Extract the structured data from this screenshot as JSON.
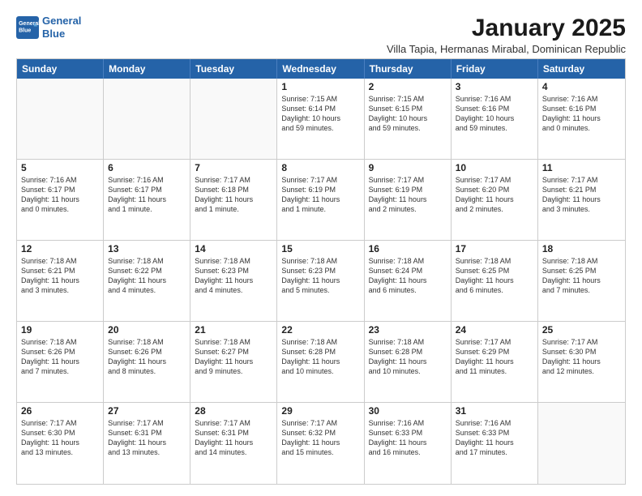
{
  "logo": {
    "line1": "General",
    "line2": "Blue"
  },
  "title": "January 2025",
  "subtitle": "Villa Tapia, Hermanas Mirabal, Dominican Republic",
  "dayHeaders": [
    "Sunday",
    "Monday",
    "Tuesday",
    "Wednesday",
    "Thursday",
    "Friday",
    "Saturday"
  ],
  "weeks": [
    [
      {
        "date": "",
        "info": ""
      },
      {
        "date": "",
        "info": ""
      },
      {
        "date": "",
        "info": ""
      },
      {
        "date": "1",
        "info": "Sunrise: 7:15 AM\nSunset: 6:14 PM\nDaylight: 10 hours\nand 59 minutes."
      },
      {
        "date": "2",
        "info": "Sunrise: 7:15 AM\nSunset: 6:15 PM\nDaylight: 10 hours\nand 59 minutes."
      },
      {
        "date": "3",
        "info": "Sunrise: 7:16 AM\nSunset: 6:16 PM\nDaylight: 10 hours\nand 59 minutes."
      },
      {
        "date": "4",
        "info": "Sunrise: 7:16 AM\nSunset: 6:16 PM\nDaylight: 11 hours\nand 0 minutes."
      }
    ],
    [
      {
        "date": "5",
        "info": "Sunrise: 7:16 AM\nSunset: 6:17 PM\nDaylight: 11 hours\nand 0 minutes."
      },
      {
        "date": "6",
        "info": "Sunrise: 7:16 AM\nSunset: 6:17 PM\nDaylight: 11 hours\nand 1 minute."
      },
      {
        "date": "7",
        "info": "Sunrise: 7:17 AM\nSunset: 6:18 PM\nDaylight: 11 hours\nand 1 minute."
      },
      {
        "date": "8",
        "info": "Sunrise: 7:17 AM\nSunset: 6:19 PM\nDaylight: 11 hours\nand 1 minute."
      },
      {
        "date": "9",
        "info": "Sunrise: 7:17 AM\nSunset: 6:19 PM\nDaylight: 11 hours\nand 2 minutes."
      },
      {
        "date": "10",
        "info": "Sunrise: 7:17 AM\nSunset: 6:20 PM\nDaylight: 11 hours\nand 2 minutes."
      },
      {
        "date": "11",
        "info": "Sunrise: 7:17 AM\nSunset: 6:21 PM\nDaylight: 11 hours\nand 3 minutes."
      }
    ],
    [
      {
        "date": "12",
        "info": "Sunrise: 7:18 AM\nSunset: 6:21 PM\nDaylight: 11 hours\nand 3 minutes."
      },
      {
        "date": "13",
        "info": "Sunrise: 7:18 AM\nSunset: 6:22 PM\nDaylight: 11 hours\nand 4 minutes."
      },
      {
        "date": "14",
        "info": "Sunrise: 7:18 AM\nSunset: 6:23 PM\nDaylight: 11 hours\nand 4 minutes."
      },
      {
        "date": "15",
        "info": "Sunrise: 7:18 AM\nSunset: 6:23 PM\nDaylight: 11 hours\nand 5 minutes."
      },
      {
        "date": "16",
        "info": "Sunrise: 7:18 AM\nSunset: 6:24 PM\nDaylight: 11 hours\nand 6 minutes."
      },
      {
        "date": "17",
        "info": "Sunrise: 7:18 AM\nSunset: 6:25 PM\nDaylight: 11 hours\nand 6 minutes."
      },
      {
        "date": "18",
        "info": "Sunrise: 7:18 AM\nSunset: 6:25 PM\nDaylight: 11 hours\nand 7 minutes."
      }
    ],
    [
      {
        "date": "19",
        "info": "Sunrise: 7:18 AM\nSunset: 6:26 PM\nDaylight: 11 hours\nand 7 minutes."
      },
      {
        "date": "20",
        "info": "Sunrise: 7:18 AM\nSunset: 6:26 PM\nDaylight: 11 hours\nand 8 minutes."
      },
      {
        "date": "21",
        "info": "Sunrise: 7:18 AM\nSunset: 6:27 PM\nDaylight: 11 hours\nand 9 minutes."
      },
      {
        "date": "22",
        "info": "Sunrise: 7:18 AM\nSunset: 6:28 PM\nDaylight: 11 hours\nand 10 minutes."
      },
      {
        "date": "23",
        "info": "Sunrise: 7:18 AM\nSunset: 6:28 PM\nDaylight: 11 hours\nand 10 minutes."
      },
      {
        "date": "24",
        "info": "Sunrise: 7:17 AM\nSunset: 6:29 PM\nDaylight: 11 hours\nand 11 minutes."
      },
      {
        "date": "25",
        "info": "Sunrise: 7:17 AM\nSunset: 6:30 PM\nDaylight: 11 hours\nand 12 minutes."
      }
    ],
    [
      {
        "date": "26",
        "info": "Sunrise: 7:17 AM\nSunset: 6:30 PM\nDaylight: 11 hours\nand 13 minutes."
      },
      {
        "date": "27",
        "info": "Sunrise: 7:17 AM\nSunset: 6:31 PM\nDaylight: 11 hours\nand 13 minutes."
      },
      {
        "date": "28",
        "info": "Sunrise: 7:17 AM\nSunset: 6:31 PM\nDaylight: 11 hours\nand 14 minutes."
      },
      {
        "date": "29",
        "info": "Sunrise: 7:17 AM\nSunset: 6:32 PM\nDaylight: 11 hours\nand 15 minutes."
      },
      {
        "date": "30",
        "info": "Sunrise: 7:16 AM\nSunset: 6:33 PM\nDaylight: 11 hours\nand 16 minutes."
      },
      {
        "date": "31",
        "info": "Sunrise: 7:16 AM\nSunset: 6:33 PM\nDaylight: 11 hours\nand 17 minutes."
      },
      {
        "date": "",
        "info": ""
      }
    ]
  ]
}
